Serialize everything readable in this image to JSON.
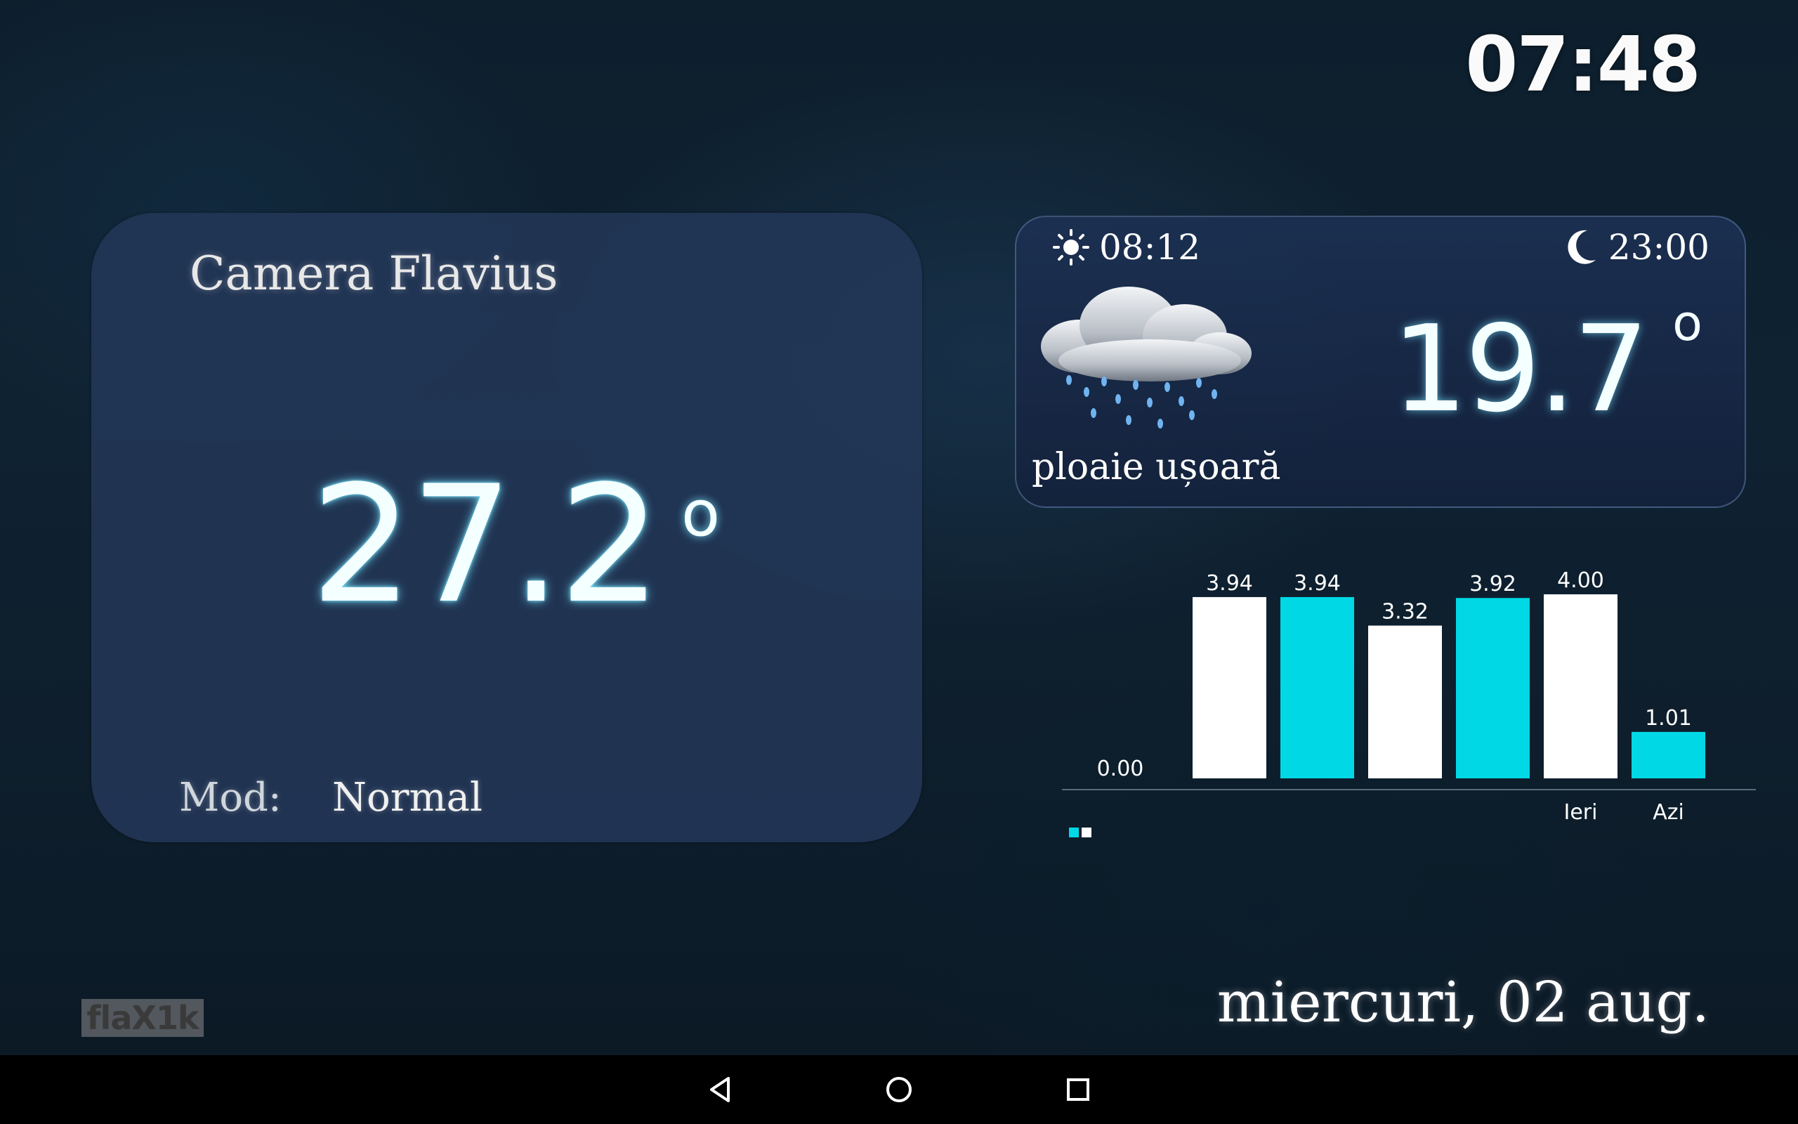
{
  "status": {
    "clock": "07:48"
  },
  "room": {
    "title": "Camera Flavius",
    "temperature": "27.2",
    "degree_symbol": "o",
    "mode_label": "Mod:",
    "mode_value": "Normal"
  },
  "weather": {
    "sunrise": "08:12",
    "moonset": "23:00",
    "temperature": "19.7",
    "degree_symbol": "o",
    "description": "ploaie ușoară",
    "icon": "rain-cloud-icon"
  },
  "chart_data": {
    "type": "bar",
    "categories": [
      "",
      "",
      "",
      "",
      "Ieri",
      "Azi"
    ],
    "values": [
      3.94,
      3.94,
      3.32,
      3.92,
      4.0,
      1.01
    ],
    "value_labels": [
      "3.94",
      "3.94",
      "3.32",
      "3.92",
      "4.00",
      "1.01"
    ],
    "bar_colors": [
      "#ffffff",
      "#00d8e6",
      "#ffffff",
      "#00d8e6",
      "#ffffff",
      "#00d8e6"
    ],
    "y_min_label": "0.00",
    "ylim": [
      0,
      4.0
    ],
    "legend_colors": [
      "#00d8e6",
      "#ffffff"
    ],
    "grid": false
  },
  "footer": {
    "logo": "flaX1k",
    "date": "miercuri, 02 aug."
  },
  "navbar": {
    "back_icon": "back-triangle-icon",
    "home_icon": "home-circle-icon",
    "recents_icon": "recents-square-icon"
  },
  "colors": {
    "accent": "#00d8e6",
    "card": "#223656",
    "background": "#0f2232"
  }
}
